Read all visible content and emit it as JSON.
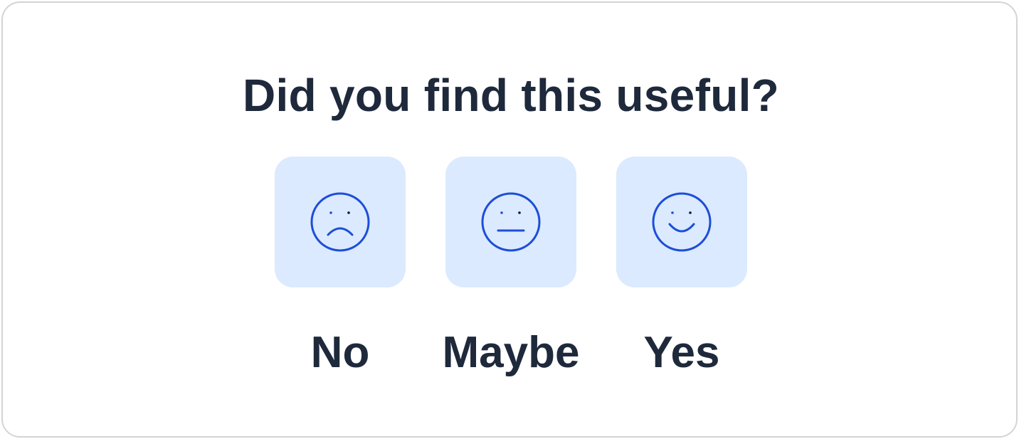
{
  "feedback": {
    "title": "Did you find this useful?",
    "options": [
      {
        "label": "No",
        "icon": "frown-face-icon"
      },
      {
        "label": "Maybe",
        "icon": "neutral-face-icon"
      },
      {
        "label": "Yes",
        "icon": "smile-face-icon"
      }
    ]
  },
  "colors": {
    "text": "#1e293b",
    "button_bg": "#dbeafe",
    "icon_stroke": "#1d4ed8",
    "border": "#d4d4d8"
  }
}
